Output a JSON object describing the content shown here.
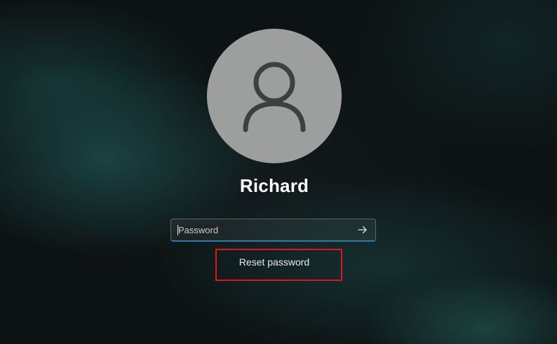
{
  "user": {
    "name": "Richard",
    "avatar_icon": "person-icon"
  },
  "password": {
    "placeholder": "Password",
    "value": "",
    "submit_icon": "arrow-right-icon"
  },
  "links": {
    "reset_password": "Reset password"
  },
  "colors": {
    "avatar_bg": "#9d9e9e",
    "input_focus_border": "#2d7bb5",
    "highlight_box": "#e0141e"
  }
}
